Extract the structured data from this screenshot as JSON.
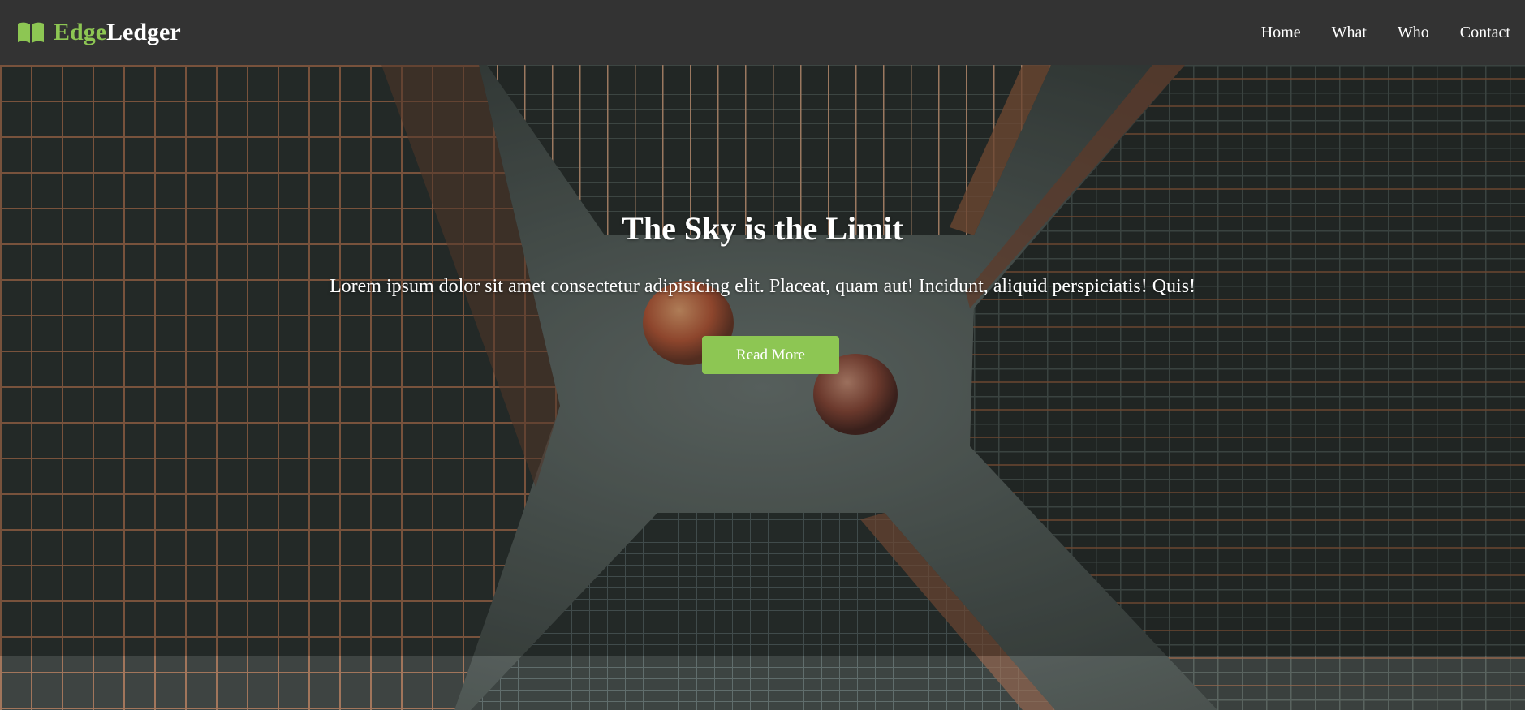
{
  "brand": {
    "name_accent": "Edge",
    "name_rest": "Ledger",
    "icon": "book-open-icon",
    "accent_color": "#8dc653"
  },
  "nav": {
    "items": [
      {
        "label": "Home"
      },
      {
        "label": "What"
      },
      {
        "label": "Who"
      },
      {
        "label": "Contact"
      }
    ]
  },
  "hero": {
    "title": "The Sky is the Limit",
    "text": "Lorem ipsum dolor sit amet consectetur adipisicing elit. Placeat, quam aut! Incidunt, aliquid perspiciatis! Quis!",
    "button_label": "Read More",
    "button_color": "#8dc653"
  },
  "colors": {
    "navbar_bg": "#333333",
    "text": "#ffffff"
  }
}
